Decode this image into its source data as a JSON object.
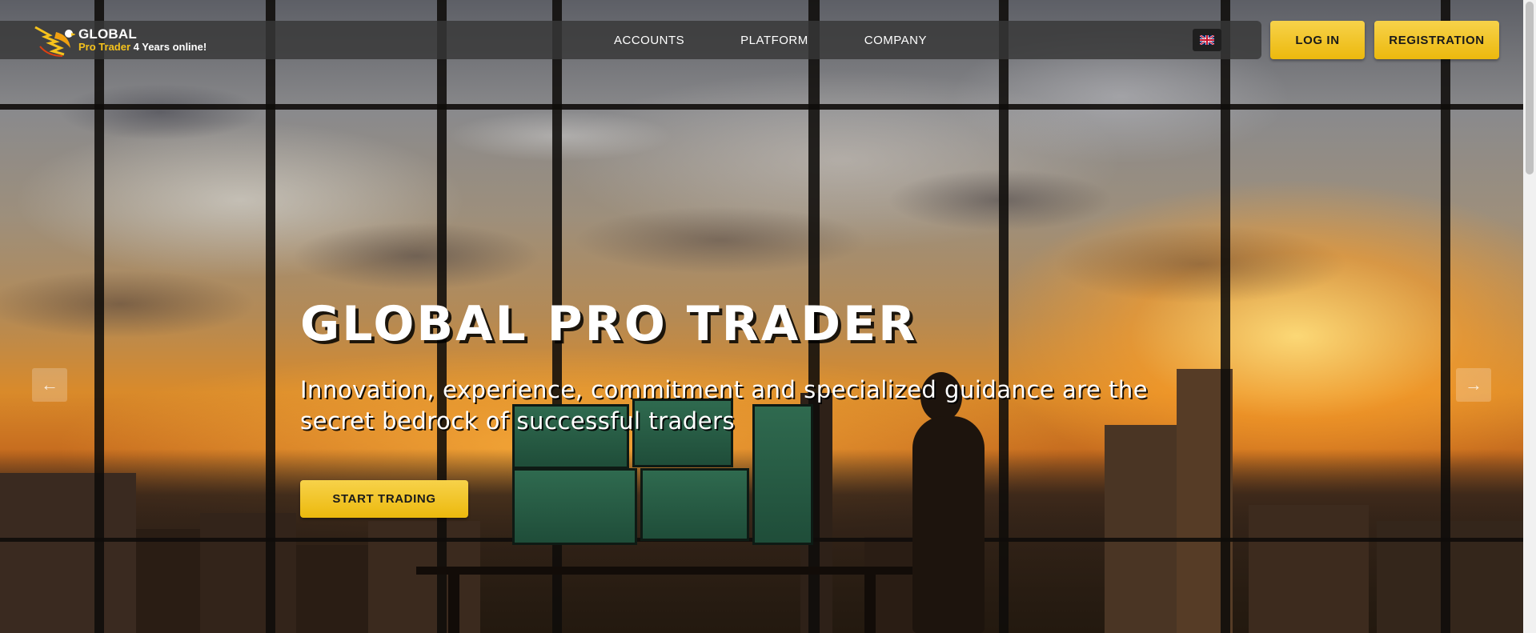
{
  "brand": {
    "line1": "GLOBAL",
    "line2_gold": "Pro Trader",
    "line2_white": " 4 Years online!",
    "accent_color": "#f5c21c"
  },
  "nav": {
    "items": [
      {
        "label": "ACCOUNTS"
      },
      {
        "label": "PLATFORM"
      },
      {
        "label": "COMPANY"
      }
    ]
  },
  "language": {
    "flag_icon": "uk-flag-icon"
  },
  "auth": {
    "login_label": "LOG IN",
    "register_label": "REGISTRATION"
  },
  "hero": {
    "title": "GLOBAL PRO TRADER",
    "subtitle": "Innovation, experience, commitment and specialized guidance are the secret bedrock of successful traders",
    "cta_label": "START TRADING",
    "prev_icon": "arrow-left-icon",
    "next_icon": "arrow-right-icon"
  }
}
